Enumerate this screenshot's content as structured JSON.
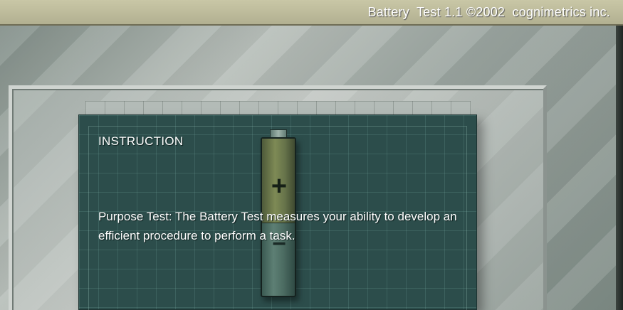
{
  "window": {
    "title": "Battery  Test 1.1 ©2002  cognimetrics inc."
  },
  "instruction": {
    "heading": "INSTRUCTION",
    "body": "Purpose Test:  The Battery Test measures your ability to develop an efficient procedure to perform a task."
  },
  "battery": {
    "positive_symbol": "+",
    "negative_symbol": "−"
  },
  "colors": {
    "board": "#2c4d4b",
    "titlebar": "#c9c7a6",
    "text": "#ffffff"
  }
}
